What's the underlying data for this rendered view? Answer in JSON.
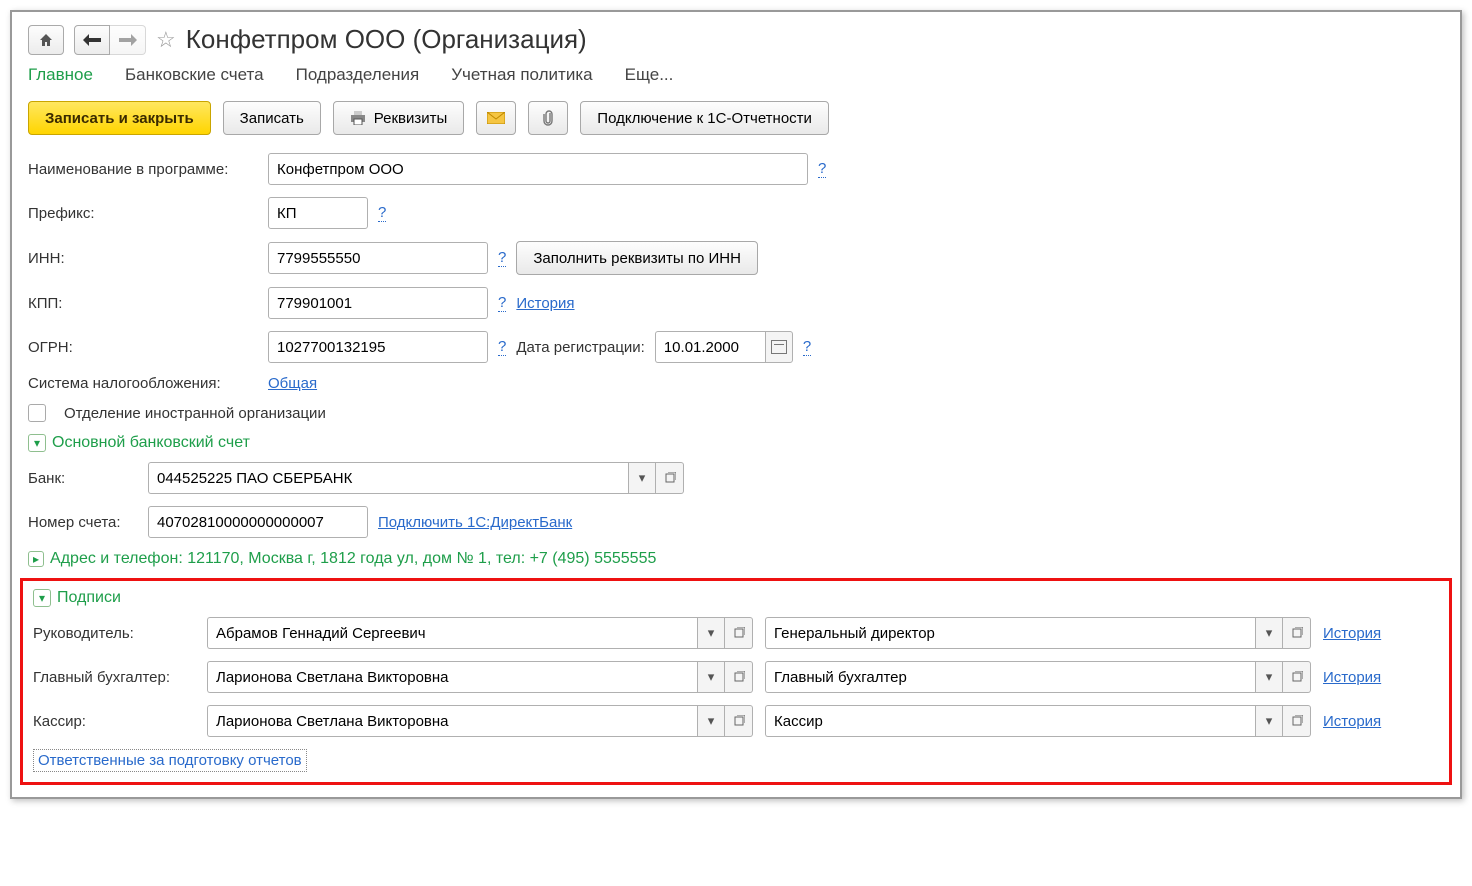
{
  "title": "Конфетпром ООО (Организация)",
  "tabs": {
    "main": "Главное",
    "bank": "Банковские счета",
    "dept": "Подразделения",
    "policy": "Учетная политика",
    "more": "Еще..."
  },
  "toolbar": {
    "save_close": "Записать и закрыть",
    "save": "Записать",
    "props": "Реквизиты",
    "connect": "Подключение к 1С-Отчетности"
  },
  "fields": {
    "name_label": "Наименование в программе:",
    "name_value": "Конфетпром ООО",
    "prefix_label": "Префикс:",
    "prefix_value": "КП",
    "inn_label": "ИНН:",
    "inn_value": "7799555550",
    "fill_by_inn": "Заполнить реквизиты по ИНН",
    "kpp_label": "КПП:",
    "kpp_value": "779901001",
    "history": "История",
    "ogrn_label": "ОГРН:",
    "ogrn_value": "1027700132195",
    "regdate_label": "Дата регистрации:",
    "regdate_value": "10.01.2000",
    "tax_label": "Система налогообложения:",
    "tax_value": "Общая",
    "foreign_label": "Отделение иностранной организации"
  },
  "bank": {
    "section": "Основной банковский счет",
    "bank_label": "Банк:",
    "bank_value": "044525225 ПАО СБЕРБАНК",
    "acct_label": "Номер счета:",
    "acct_value": "40702810000000000007",
    "directbank": "Подключить 1С:ДиректБанк"
  },
  "address": {
    "line": "Адрес и телефон: 121170, Москва г, 1812 года ул, дом № 1, тел: +7 (495) 5555555"
  },
  "signatures": {
    "title": "Подписи",
    "director_label": "Руководитель:",
    "director_name": "Абрамов Геннадий Сергеевич",
    "director_pos": "Генеральный директор",
    "accountant_label": "Главный бухгалтер:",
    "accountant_name": "Ларионова Светлана Викторовна",
    "accountant_pos": "Главный бухгалтер",
    "cashier_label": "Кассир:",
    "cashier_name": "Ларионова Светлана Викторовна",
    "cashier_pos": "Кассир",
    "history": "История",
    "responsibles": "Ответственные за подготовку отчетов"
  },
  "help": "?"
}
